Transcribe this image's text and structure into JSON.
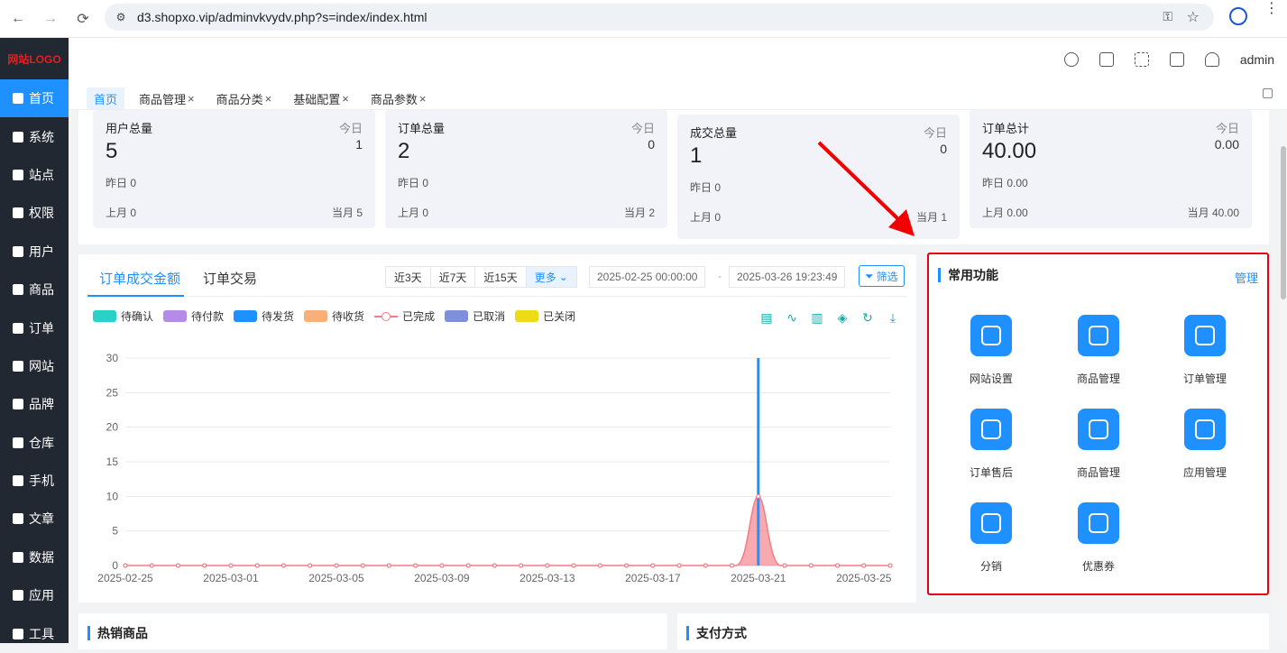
{
  "browser": {
    "url": "d3.shopxo.vip/adminvkvydv.php?s=index/index.html"
  },
  "sidebar": {
    "logo": "网站LOGO",
    "items": [
      {
        "label": "首页",
        "icon": "home-icon"
      },
      {
        "label": "系统",
        "icon": "gear-icon"
      },
      {
        "label": "站点",
        "icon": "sliders-icon"
      },
      {
        "label": "权限",
        "icon": "user-lock-icon"
      },
      {
        "label": "用户",
        "icon": "users-icon"
      },
      {
        "label": "商品",
        "icon": "box-icon"
      },
      {
        "label": "订单",
        "icon": "order-icon"
      },
      {
        "label": "网站",
        "icon": "monitor-icon"
      },
      {
        "label": "品牌",
        "icon": "brand-icon"
      },
      {
        "label": "仓库",
        "icon": "warehouse-icon"
      },
      {
        "label": "手机",
        "icon": "phone-icon"
      },
      {
        "label": "文章",
        "icon": "article-icon"
      },
      {
        "label": "数据",
        "icon": "chart-icon"
      },
      {
        "label": "应用",
        "icon": "apps-icon"
      },
      {
        "label": "工具",
        "icon": "wrench-icon"
      }
    ]
  },
  "topbar": {
    "user": "admin"
  },
  "tabs": [
    {
      "label": "首页",
      "closable": false
    },
    {
      "label": "商品管理",
      "closable": true
    },
    {
      "label": "商品分类",
      "closable": true
    },
    {
      "label": "基础配置",
      "closable": true
    },
    {
      "label": "商品参数",
      "closable": true
    }
  ],
  "close_glyph": "×",
  "stats": [
    {
      "title": "用户总量",
      "value": "5",
      "today_label": "今日",
      "today": "1",
      "yesterday": "昨日  0",
      "last_month": "上月  0",
      "this_month": "当月  5"
    },
    {
      "title": "订单总量",
      "value": "2",
      "today_label": "今日",
      "today": "0",
      "yesterday": "昨日 0",
      "last_month": "上月  0",
      "this_month": "当月  2"
    },
    {
      "title": "成交总量",
      "value": "1",
      "today_label": "今日",
      "today": "0",
      "yesterday": "昨日 0",
      "last_month": "上月  0",
      "this_month": "当月  1"
    },
    {
      "title": "订单总计",
      "value": "40.00",
      "today_label": "今日",
      "today": "0.00",
      "yesterday": "昨日 0.00",
      "last_month": "上月  0.00",
      "this_month": "当月  40.00"
    }
  ],
  "chart_panel": {
    "tabs": [
      "订单成交金额",
      "订单交易"
    ],
    "ranges": [
      "近3天",
      "近7天",
      "近15天",
      "更多"
    ],
    "start": "2025-02-25 00:00:00",
    "sep": "-",
    "end": "2025-03-26 19:23:49",
    "filter": "筛选"
  },
  "chart_data": {
    "type": "line",
    "legend": [
      {
        "name": "待确认",
        "color": "#2ad1c6"
      },
      {
        "name": "待付款",
        "color": "#b58be8"
      },
      {
        "name": "待发货",
        "color": "#1e90ff"
      },
      {
        "name": "待收货",
        "color": "#f7b07a"
      },
      {
        "name": "已完成",
        "color": "#f47c85"
      },
      {
        "name": "已取消",
        "color": "#7f8fdc"
      },
      {
        "name": "已关闭",
        "color": "#ecdc16"
      }
    ],
    "ylim": [
      0,
      30
    ],
    "yticks": [
      "0",
      "5",
      "10",
      "15",
      "20",
      "25",
      "30"
    ],
    "xticks": [
      "2025-02-25",
      "2025-03-01",
      "2025-03-05",
      "2025-03-09",
      "2025-03-13",
      "2025-03-17",
      "2025-03-21",
      "2025-03-25"
    ],
    "x": [
      "2025-02-25",
      "2025-02-26",
      "2025-02-27",
      "2025-02-28",
      "2025-03-01",
      "2025-03-02",
      "2025-03-03",
      "2025-03-04",
      "2025-03-05",
      "2025-03-06",
      "2025-03-07",
      "2025-03-08",
      "2025-03-09",
      "2025-03-10",
      "2025-03-11",
      "2025-03-12",
      "2025-03-13",
      "2025-03-14",
      "2025-03-15",
      "2025-03-16",
      "2025-03-17",
      "2025-03-18",
      "2025-03-19",
      "2025-03-20",
      "2025-03-21",
      "2025-03-22",
      "2025-03-23",
      "2025-03-24",
      "2025-03-25",
      "2025-03-26"
    ],
    "series": [
      {
        "name": "待发货",
        "type": "bar",
        "values": [
          0,
          0,
          0,
          0,
          0,
          0,
          0,
          0,
          0,
          0,
          0,
          0,
          0,
          0,
          0,
          0,
          0,
          0,
          0,
          0,
          0,
          0,
          0,
          0,
          30,
          0,
          0,
          0,
          0,
          0
        ]
      },
      {
        "name": "已完成",
        "type": "area",
        "values": [
          0,
          0,
          0,
          0,
          0,
          0,
          0,
          0,
          0,
          0,
          0,
          0,
          0,
          0,
          0,
          0,
          0,
          0,
          0,
          0,
          0,
          0,
          0,
          0,
          10,
          0,
          0,
          0,
          0,
          0
        ]
      }
    ]
  },
  "quick": {
    "title": "常用功能",
    "manage": "管理",
    "items": [
      {
        "label": "网站设置",
        "icon": "site-settings-icon"
      },
      {
        "label": "商品管理",
        "icon": "goods-icon"
      },
      {
        "label": "订单管理",
        "icon": "order-doc-icon"
      },
      {
        "label": "订单售后",
        "icon": "aftersale-icon"
      },
      {
        "label": "商品管理",
        "icon": "goods-icon"
      },
      {
        "label": "应用管理",
        "icon": "apps-icon"
      },
      {
        "label": "分销",
        "icon": "distribution-icon"
      },
      {
        "label": "优惠券",
        "icon": "coupon-icon"
      }
    ]
  },
  "bottom": {
    "hot": "热销商品",
    "pay": "支付方式"
  }
}
